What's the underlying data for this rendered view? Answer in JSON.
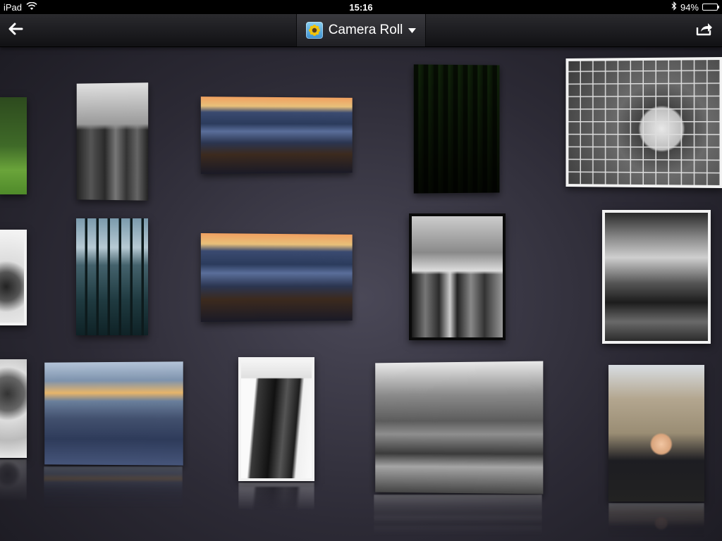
{
  "status_bar": {
    "device": "iPad",
    "time": "15:16",
    "battery_percent": "94%",
    "battery_level": 0.94,
    "icons": [
      "wifi-icon",
      "bluetooth-icon",
      "battery-icon"
    ]
  },
  "nav_bar": {
    "album_title": "Camera Roll",
    "icons": [
      "back-arrow-icon",
      "album-sunflower-icon",
      "chevron-down-icon",
      "share-icon"
    ]
  },
  "photos": [
    {
      "name": "photo-grass-field",
      "style": "p-green"
    },
    {
      "name": "photo-empire-state-bw",
      "style": "p-nyc-bw"
    },
    {
      "name": "photo-hoboken-sunset",
      "style": "p-sunset"
    },
    {
      "name": "photo-forest",
      "style": "p-forest"
    },
    {
      "name": "photo-goalkeeper",
      "style": "p-goalie"
    },
    {
      "name": "photo-girl-bw",
      "style": "p-girl-bw"
    },
    {
      "name": "photo-pier-pilings",
      "style": "p-pier"
    },
    {
      "name": "photo-hoboken-sunset-2",
      "style": "p-sunset"
    },
    {
      "name": "photo-empire-state-screenshot",
      "style": "p-nyc-bw2"
    },
    {
      "name": "photo-tower-bridge",
      "style": "p-tower-bridge"
    },
    {
      "name": "photo-girl-bw-2",
      "style": "p-girl-bw2"
    },
    {
      "name": "photo-kayakers",
      "style": "p-kayak"
    },
    {
      "name": "photo-building-bw",
      "style": "p-building"
    },
    {
      "name": "photo-street-sculpture",
      "style": "p-brighton"
    },
    {
      "name": "photo-boy-tower-bridge",
      "style": "p-boy"
    }
  ]
}
